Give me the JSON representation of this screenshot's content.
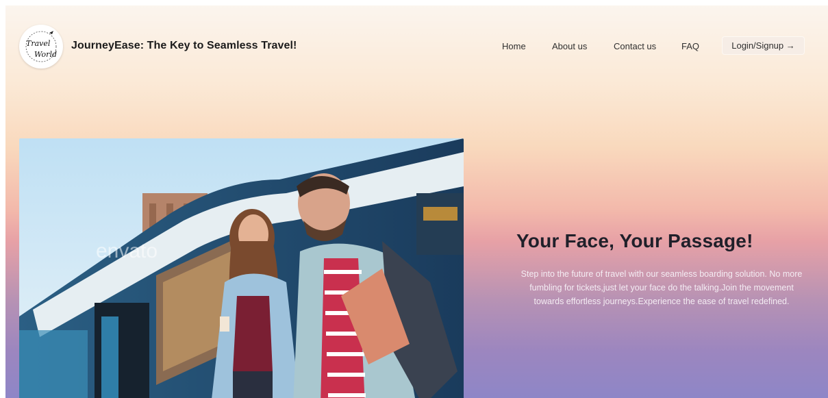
{
  "header": {
    "logo_text_1": "Travel",
    "logo_text_2": "World",
    "title": "JourneyEase: The Key to Seamless Travel!"
  },
  "nav": {
    "home": "Home",
    "about": "About us",
    "contact": "Contact us",
    "faq": "FAQ",
    "login": "Login/Signup →"
  },
  "hero": {
    "headline": "Your Face, Your Passage!",
    "description": "Step into the future of travel with our seamless boarding solution. No more fumbling for tickets,just let your face do the talking.Join the movement towards effortless journeys.Experience the ease of travel redefined.",
    "watermark": "envato"
  }
}
